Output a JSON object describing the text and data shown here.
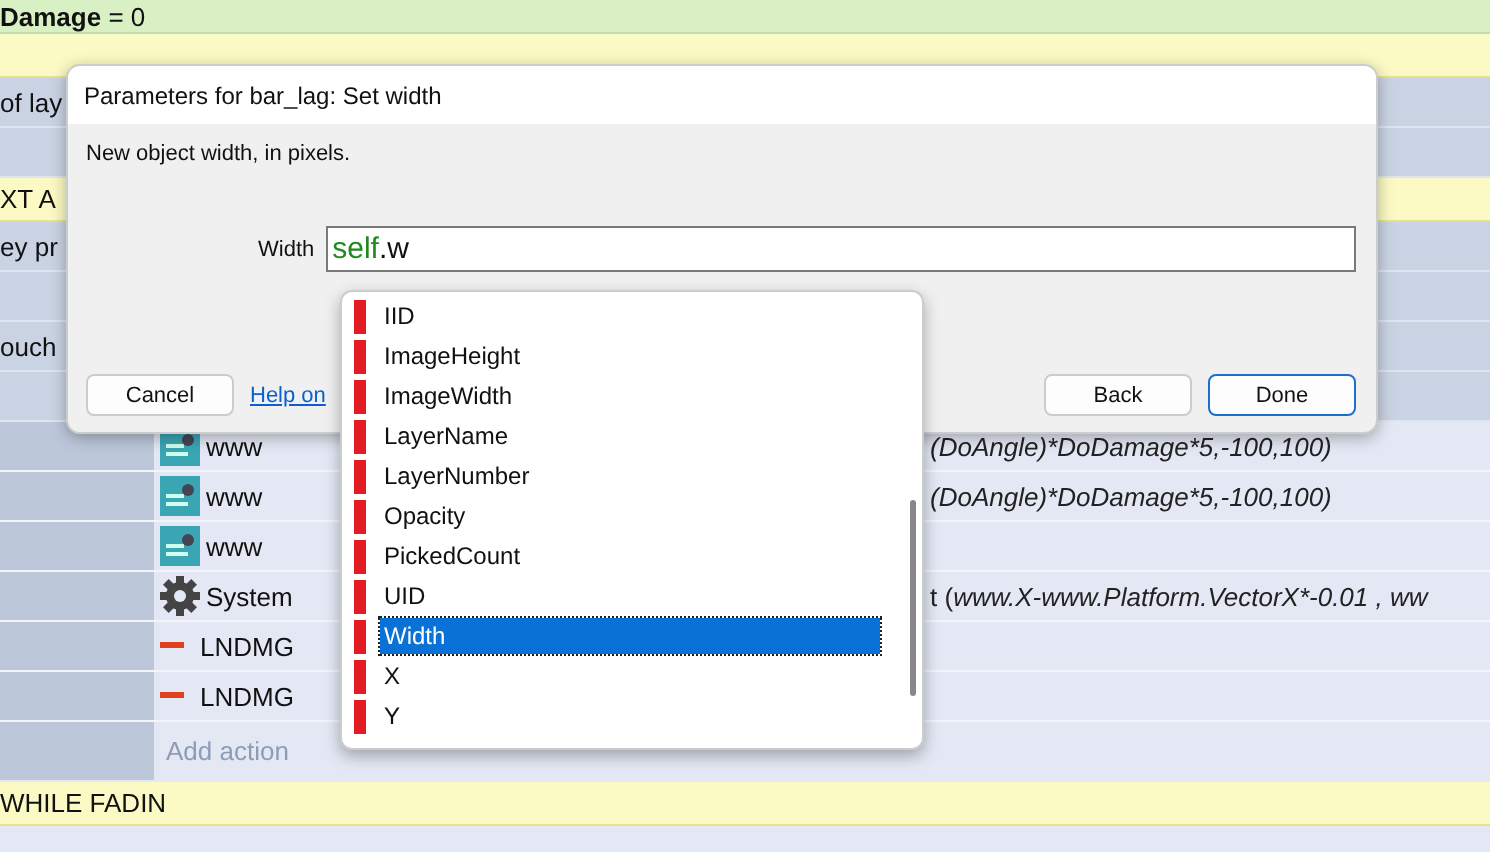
{
  "event_sheet": {
    "rows": [
      {
        "kind": "variable",
        "text": "**Damage** = 0"
      },
      {
        "kind": "group"
      },
      {
        "kind": "condition",
        "text": "of lay"
      },
      {
        "kind": "condition"
      },
      {
        "kind": "group",
        "text": "XT A"
      },
      {
        "kind": "condition",
        "text": "ey pr"
      },
      {
        "kind": "condition"
      },
      {
        "kind": "condition",
        "text": "ouch"
      },
      {
        "kind": "condition"
      },
      {
        "kind": "sprite_action",
        "object": "www",
        "expression": "(DoAngle)*DoDamage*5,-100,100)"
      },
      {
        "kind": "sprite_action",
        "object": "www",
        "expression": "(DoAngle)*DoDamage*5,-100,100)"
      },
      {
        "kind": "sprite_action",
        "object": "www"
      },
      {
        "kind": "system_action",
        "object": "System",
        "prefix": "t (",
        "expression": "www.X-www.Platform.VectorX*-0.01  , ww"
      },
      {
        "kind": "variable_action",
        "object": "LNDMG"
      },
      {
        "kind": "variable_action",
        "object": "LNDMG"
      },
      {
        "kind": "add_action",
        "text": "Add action"
      },
      {
        "kind": "group",
        "text": "WHILE FADIN"
      }
    ]
  },
  "dialog": {
    "title": "Parameters for bar_lag: Set width",
    "description": "New object width, in pixels.",
    "field": {
      "label": "Width",
      "keyword": "self",
      "rest": ".w"
    },
    "buttons": [
      {
        "label": "Cancel",
        "kind": "plain"
      },
      {
        "label": "Help on",
        "kind": "link"
      },
      {
        "label": "Back",
        "kind": "plain"
      },
      {
        "label": "Done",
        "kind": "default"
      }
    ]
  },
  "autocomplete": {
    "items": [
      {
        "label": "IID",
        "selected": false
      },
      {
        "label": "ImageHeight",
        "selected": false
      },
      {
        "label": "ImageWidth",
        "selected": false
      },
      {
        "label": "LayerName",
        "selected": false
      },
      {
        "label": "LayerNumber",
        "selected": false
      },
      {
        "label": "Opacity",
        "selected": false
      },
      {
        "label": "PickedCount",
        "selected": false
      },
      {
        "label": "UID",
        "selected": false
      },
      {
        "label": "Width",
        "selected": true
      },
      {
        "label": "X",
        "selected": false
      },
      {
        "label": "Y",
        "selected": false
      }
    ]
  }
}
